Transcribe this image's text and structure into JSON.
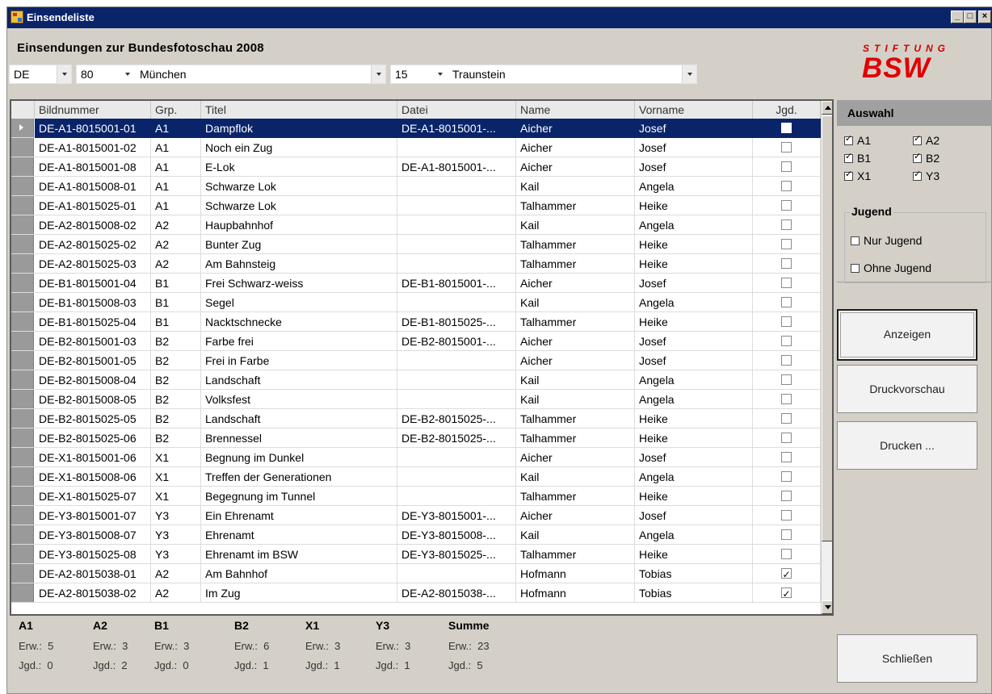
{
  "window": {
    "title": "Einsendeliste",
    "min": "_",
    "max": "□",
    "close": "×"
  },
  "heading": "Einsendungen zur Bundesfotoschau 2008",
  "filters": {
    "land": "DE",
    "bezirk_nr": "80",
    "bezirk": "München",
    "verein_nr": "15",
    "verein": "Traunstein"
  },
  "logo": {
    "top": "STIFTUNG",
    "main": "BSW",
    "color": "#e00000"
  },
  "columns": [
    "Bildnummer",
    "Grp.",
    "Titel",
    "Datei",
    "Name",
    "Vorname",
    "Jgd."
  ],
  "rows": [
    {
      "bild": "DE-A1-8015001-01",
      "grp": "A1",
      "titel": "Dampflok",
      "datei": "DE-A1-8015001-...",
      "name": "Aicher",
      "vorname": "Josef",
      "jgd": false
    },
    {
      "bild": "DE-A1-8015001-02",
      "grp": "A1",
      "titel": "Noch ein Zug",
      "datei": "",
      "name": "Aicher",
      "vorname": "Josef",
      "jgd": false
    },
    {
      "bild": "DE-A1-8015001-08",
      "grp": "A1",
      "titel": "E-Lok",
      "datei": "DE-A1-8015001-...",
      "name": "Aicher",
      "vorname": "Josef",
      "jgd": false
    },
    {
      "bild": "DE-A1-8015008-01",
      "grp": "A1",
      "titel": "Schwarze Lok",
      "datei": "",
      "name": "Kail",
      "vorname": "Angela",
      "jgd": false
    },
    {
      "bild": "DE-A1-8015025-01",
      "grp": "A1",
      "titel": "Schwarze Lok",
      "datei": "",
      "name": "Talhammer",
      "vorname": "Heike",
      "jgd": false
    },
    {
      "bild": "DE-A2-8015008-02",
      "grp": "A2",
      "titel": "Haupbahnhof",
      "datei": "",
      "name": "Kail",
      "vorname": "Angela",
      "jgd": false
    },
    {
      "bild": "DE-A2-8015025-02",
      "grp": "A2",
      "titel": "Bunter Zug",
      "datei": "",
      "name": "Talhammer",
      "vorname": "Heike",
      "jgd": false
    },
    {
      "bild": "DE-A2-8015025-03",
      "grp": "A2",
      "titel": "Am Bahnsteig",
      "datei": "",
      "name": "Talhammer",
      "vorname": "Heike",
      "jgd": false
    },
    {
      "bild": "DE-B1-8015001-04",
      "grp": "B1",
      "titel": "Frei Schwarz-weiss",
      "datei": "DE-B1-8015001-...",
      "name": "Aicher",
      "vorname": "Josef",
      "jgd": false
    },
    {
      "bild": "DE-B1-8015008-03",
      "grp": "B1",
      "titel": "Segel",
      "datei": "",
      "name": "Kail",
      "vorname": "Angela",
      "jgd": false
    },
    {
      "bild": "DE-B1-8015025-04",
      "grp": "B1",
      "titel": " Nacktschnecke",
      "datei": "DE-B1-8015025-...",
      "name": "Talhammer",
      "vorname": "Heike",
      "jgd": false
    },
    {
      "bild": "DE-B2-8015001-03",
      "grp": "B2",
      "titel": "Farbe frei",
      "datei": "DE-B2-8015001-...",
      "name": "Aicher",
      "vorname": "Josef",
      "jgd": false
    },
    {
      "bild": "DE-B2-8015001-05",
      "grp": "B2",
      "titel": "Frei in Farbe",
      "datei": "",
      "name": "Aicher",
      "vorname": "Josef",
      "jgd": false
    },
    {
      "bild": "DE-B2-8015008-04",
      "grp": "B2",
      "titel": "Landschaft",
      "datei": "",
      "name": "Kail",
      "vorname": "Angela",
      "jgd": false
    },
    {
      "bild": "DE-B2-8015008-05",
      "grp": "B2",
      "titel": "Volksfest",
      "datei": "",
      "name": "Kail",
      "vorname": "Angela",
      "jgd": false
    },
    {
      "bild": "DE-B2-8015025-05",
      "grp": "B2",
      "titel": "Landschaft",
      "datei": "DE-B2-8015025-...",
      "name": "Talhammer",
      "vorname": "Heike",
      "jgd": false
    },
    {
      "bild": "DE-B2-8015025-06",
      "grp": "B2",
      "titel": "Brennessel",
      "datei": "DE-B2-8015025-...",
      "name": "Talhammer",
      "vorname": "Heike",
      "jgd": false
    },
    {
      "bild": "DE-X1-8015001-06",
      "grp": "X1",
      "titel": "Begnung im Dunkel",
      "datei": "",
      "name": "Aicher",
      "vorname": "Josef",
      "jgd": false
    },
    {
      "bild": "DE-X1-8015008-06",
      "grp": "X1",
      "titel": "Treffen der Generationen",
      "datei": "",
      "name": "Kail",
      "vorname": "Angela",
      "jgd": false
    },
    {
      "bild": "DE-X1-8015025-07",
      "grp": "X1",
      "titel": "Begegnung im Tunnel",
      "datei": "",
      "name": "Talhammer",
      "vorname": "Heike",
      "jgd": false
    },
    {
      "bild": "DE-Y3-8015001-07",
      "grp": "Y3",
      "titel": "Ein Ehrenamt",
      "datei": "DE-Y3-8015001-...",
      "name": "Aicher",
      "vorname": "Josef",
      "jgd": false
    },
    {
      "bild": "DE-Y3-8015008-07",
      "grp": "Y3",
      "titel": "Ehrenamt",
      "datei": "DE-Y3-8015008-...",
      "name": "Kail",
      "vorname": "Angela",
      "jgd": false
    },
    {
      "bild": "DE-Y3-8015025-08",
      "grp": "Y3",
      "titel": "Ehrenamt im BSW",
      "datei": "DE-Y3-8015025-...",
      "name": "Talhammer",
      "vorname": "Heike",
      "jgd": false
    },
    {
      "bild": "DE-A2-8015038-01",
      "grp": "A2",
      "titel": "Am Bahnhof",
      "datei": "",
      "name": "Hofmann",
      "vorname": "Tobias",
      "jgd": true
    },
    {
      "bild": "DE-A2-8015038-02",
      "grp": "A2",
      "titel": "Im Zug",
      "datei": "DE-A2-8015038-...",
      "name": "Hofmann",
      "vorname": "Tobias",
      "jgd": true
    }
  ],
  "auswahl": {
    "title": "Auswahl",
    "groups": [
      {
        "label": "A1",
        "checked": true
      },
      {
        "label": "A2",
        "checked": true
      },
      {
        "label": "B1",
        "checked": true
      },
      {
        "label": "B2",
        "checked": true
      },
      {
        "label": "X1",
        "checked": true
      },
      {
        "label": "Y3",
        "checked": true
      }
    ],
    "jugend_title": "Jugend",
    "nur_jugend": "Nur Jugend",
    "ohne_jugend": "Ohne Jugend"
  },
  "buttons": {
    "anzeigen": "Anzeigen",
    "druckvorschau": "Druckvorschau",
    "drucken": "Drucken ...",
    "schliessen": "Schließen"
  },
  "summary": [
    {
      "label": "A1",
      "erw": "Erw.:  5",
      "jgd": "Jgd.:  0"
    },
    {
      "label": "A2",
      "erw": "Erw.:  3",
      "jgd": "Jgd.:  2"
    },
    {
      "label": "B1",
      "erw": "Erw.:  3",
      "jgd": "Jgd.:  0"
    },
    {
      "label": "B2",
      "erw": "Erw.:  6",
      "jgd": "Jgd.:  1"
    },
    {
      "label": "X1",
      "erw": "Erw.:  3",
      "jgd": "Jgd.:  1"
    },
    {
      "label": "Y3",
      "erw": "Erw.:  3",
      "jgd": "Jgd.:  1"
    },
    {
      "label": "Summe",
      "erw": "Erw.:  23",
      "jgd": "Jgd.:  5"
    }
  ]
}
